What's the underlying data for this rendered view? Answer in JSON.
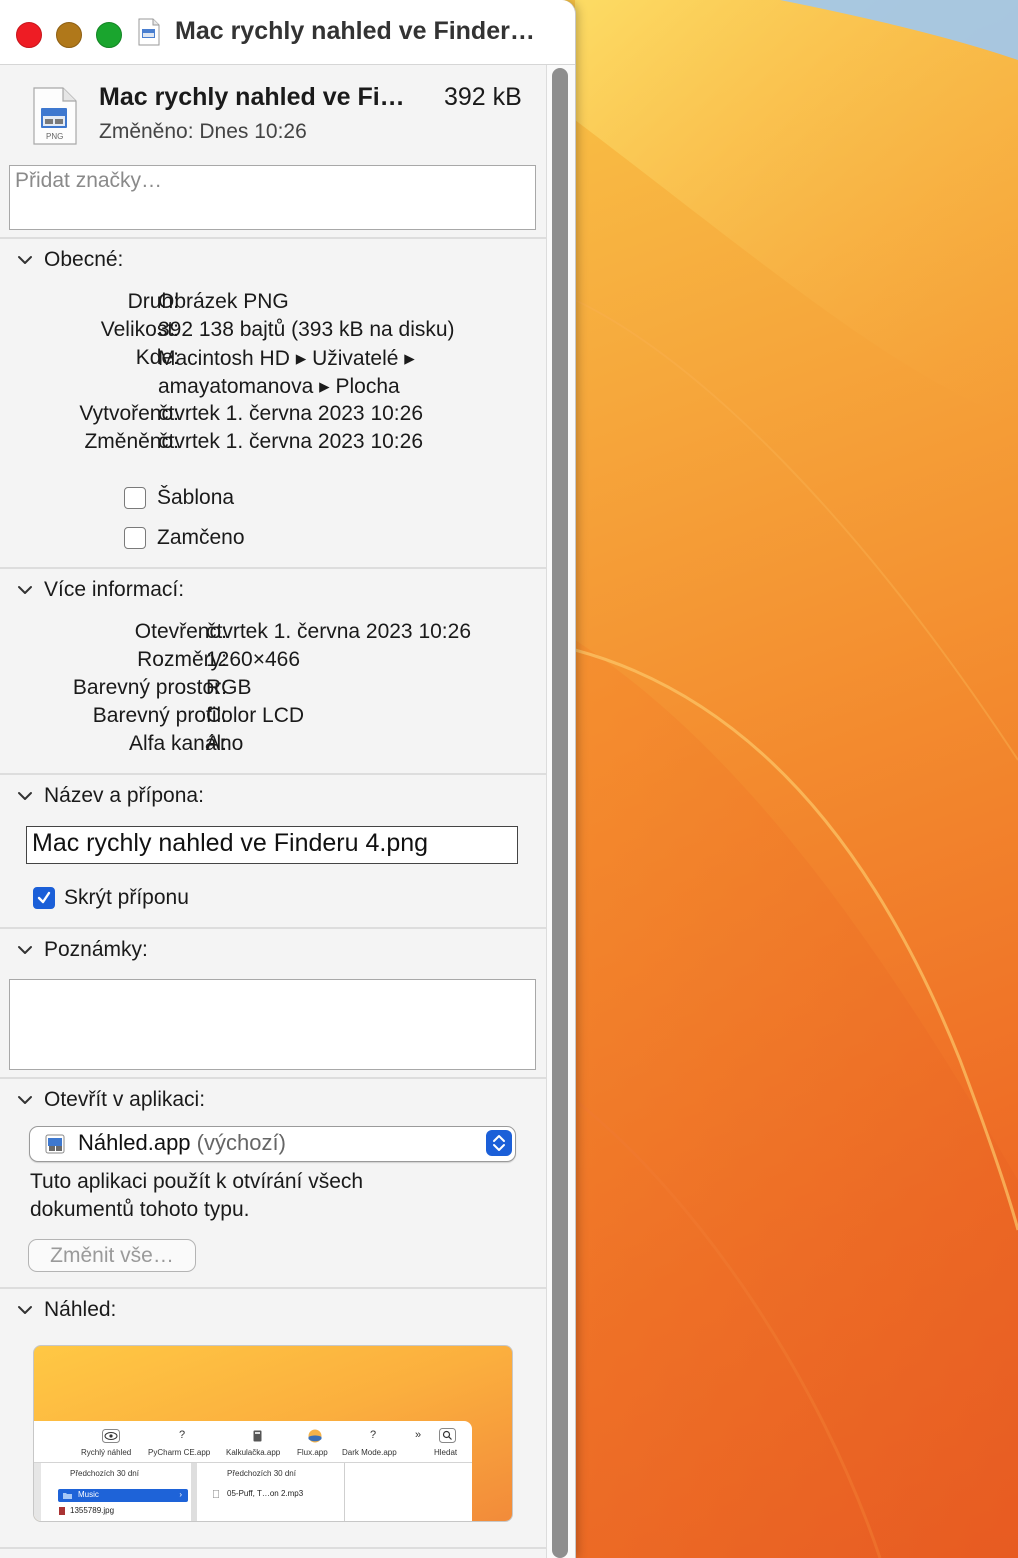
{
  "window": {
    "title": "Mac rychly nahled ve Finder…"
  },
  "header": {
    "file_name": "Mac rychly nahled ve Fi…",
    "file_size": "392 kB",
    "modified": "Změněno:  Dnes 10:26",
    "file_icon_label": "PNG",
    "tags_placeholder": "Přidat značky…"
  },
  "general": {
    "title": "Obecné:",
    "rows": [
      {
        "label": "Druh:",
        "value": "Obrázek PNG"
      },
      {
        "label": "Velikost:",
        "value": "392 138 bajtů (393 kB na disku)"
      },
      {
        "label": "Kde:",
        "value": "Macintosh HD ▸ Uživatelé ▸"
      },
      {
        "label": "",
        "value": "amayatomanova ▸ Plocha"
      },
      {
        "label": "Vytvořeno:",
        "value": "čtvrtek 1. června 2023 10:26"
      },
      {
        "label": "Změněno:",
        "value": "čtvrtek 1. června 2023 10:26"
      }
    ],
    "template_label": "Šablona",
    "template_checked": false,
    "locked_label": "Zamčeno",
    "locked_checked": false
  },
  "more_info": {
    "title": "Více informací:",
    "rows": [
      {
        "label": "Otevřeno:",
        "value": "čtvrtek 1. června 2023 10:26"
      },
      {
        "label": "Rozměry:",
        "value": "1260×466"
      },
      {
        "label": "Barevný prostor:",
        "value": "RGB"
      },
      {
        "label": "Barevný profil:",
        "value": "Color LCD"
      },
      {
        "label": "Alfa kanál:",
        "value": "Ano"
      }
    ]
  },
  "name_ext": {
    "title": "Název a přípona:",
    "value": "Mac rychly nahled ve Finderu 4.png",
    "hide_ext_label": "Skrýt příponu",
    "hide_ext_checked": true
  },
  "notes": {
    "title": "Poznámky:"
  },
  "open_with": {
    "title": "Otevřít v aplikaci:",
    "app": "Náhled.app",
    "default_suffix": "(výchozí)",
    "description_line1": "Tuto aplikaci použít k otvírání všech",
    "description_line2": "dokumentů tohoto typu.",
    "change_all_label": "Změnit vše…"
  },
  "preview": {
    "title": "Náhled:",
    "toolbar": [
      "Rychlý náhled",
      "PyCharm CE.app",
      "Kalkulačka.app",
      "Flux.app",
      "Dark Mode.app",
      "Hledat"
    ],
    "glyphs": [
      "?",
      "?",
      "»"
    ],
    "col1_header": "Předchozích 30 dní",
    "col2_header": "Předchozích 30 dní",
    "selected_item": "Music",
    "file_item": "1355789.jpg",
    "audio_item": "05-Puff, T…on 2.mp3"
  },
  "colors": {
    "accent": "#1b5fd8",
    "close": "#ee1c24",
    "minimize": "#b0781a",
    "maximize": "#1aa52e"
  }
}
